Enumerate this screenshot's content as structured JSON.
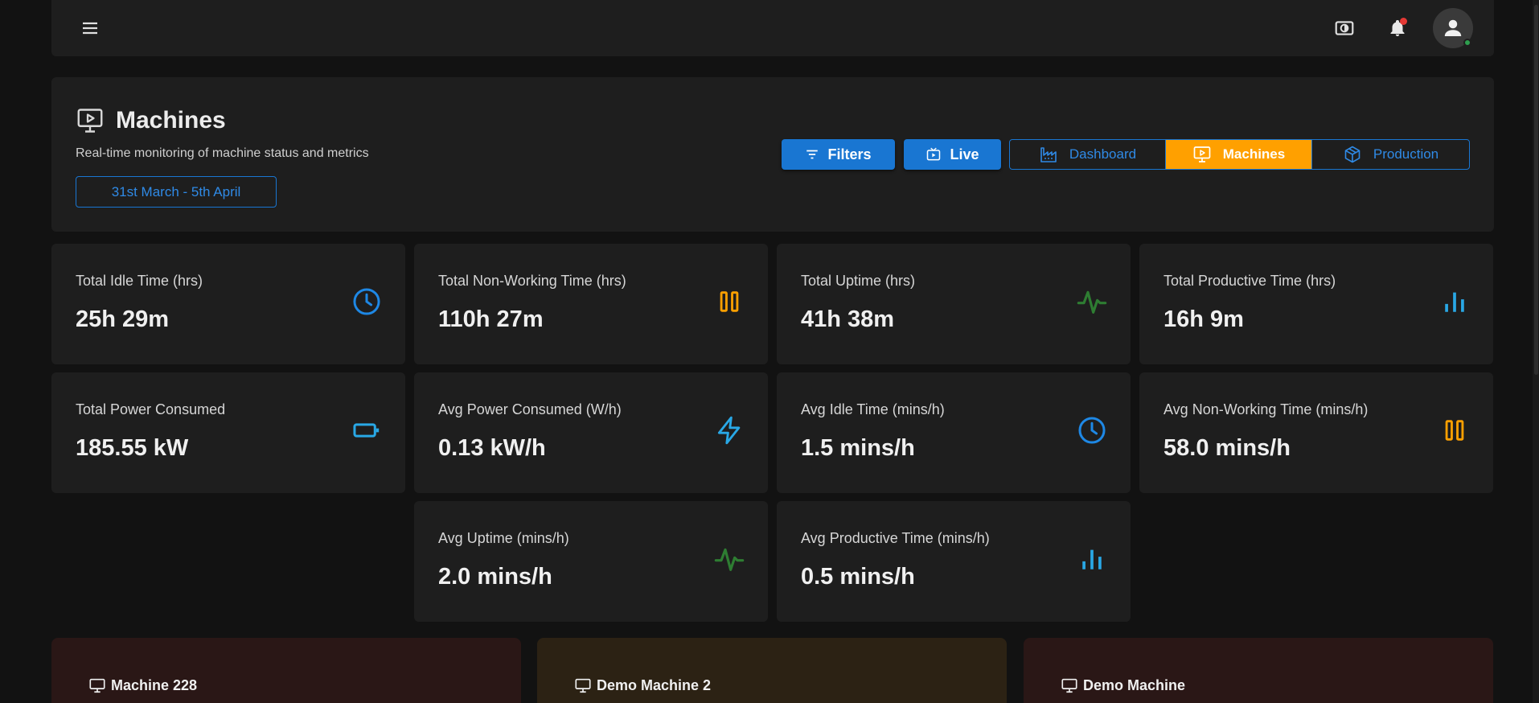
{
  "header": {
    "title": "Machines",
    "subtitle": "Real-time monitoring of machine status and metrics",
    "date_range": "31st March - 5th April",
    "filters_label": "Filters",
    "live_label": "Live",
    "nav": {
      "dashboard": "Dashboard",
      "machines": "Machines",
      "production": "Production",
      "active": "Machines"
    }
  },
  "topbar": {
    "icons": [
      "menu-icon",
      "contrast-icon",
      "bell-icon",
      "account-icon"
    ],
    "notification_dot_color": "#e53935",
    "online_dot_color": "#2e9e4e"
  },
  "stats": [
    {
      "label": "Total Idle Time (hrs)",
      "value": "25h 29m",
      "icon": "clock-icon",
      "color": "#1e88e5"
    },
    {
      "label": "Total Non-Working Time (hrs)",
      "value": "110h 27m",
      "icon": "pause-icon",
      "color": "#ffa000"
    },
    {
      "label": "Total Uptime (hrs)",
      "value": "41h 38m",
      "icon": "pulse-icon",
      "color": "#2e7d32"
    },
    {
      "label": "Total Productive Time (hrs)",
      "value": "16h 9m",
      "icon": "bar-chart-icon",
      "color": "#29a8e6"
    },
    {
      "label": "Total Power Consumed",
      "value": "185.55 kW",
      "icon": "battery-icon",
      "color": "#29a8e6"
    },
    {
      "label": "Avg Power Consumed (W/h)",
      "value": "0.13 kW/h",
      "icon": "bolt-icon",
      "color": "#29a8e6"
    },
    {
      "label": "Avg Idle Time (mins/h)",
      "value": "1.5 mins/h",
      "icon": "clock-icon",
      "color": "#1e88e5"
    },
    {
      "label": "Avg Non-Working Time (mins/h)",
      "value": "58.0 mins/h",
      "icon": "pause-icon",
      "color": "#ffa000"
    },
    {
      "label": "Avg Uptime (mins/h)",
      "value": "2.0 mins/h",
      "icon": "pulse-icon",
      "color": "#2e7d32"
    },
    {
      "label": "Avg Productive Time (mins/h)",
      "value": "0.5 mins/h",
      "icon": "bar-chart-icon",
      "color": "#29a8e6"
    }
  ],
  "machines": [
    {
      "name": "Machine 228",
      "status_color": "#2a1716"
    },
    {
      "name": "Demo Machine 2",
      "status_color": "#2c2214"
    },
    {
      "name": "Demo Machine",
      "status_color": "#2a1716"
    }
  ],
  "colors": {
    "accent": "#1976d2",
    "active_tab": "#ffa000",
    "card_bg": "#1e1e1e",
    "page_bg": "#121212"
  }
}
